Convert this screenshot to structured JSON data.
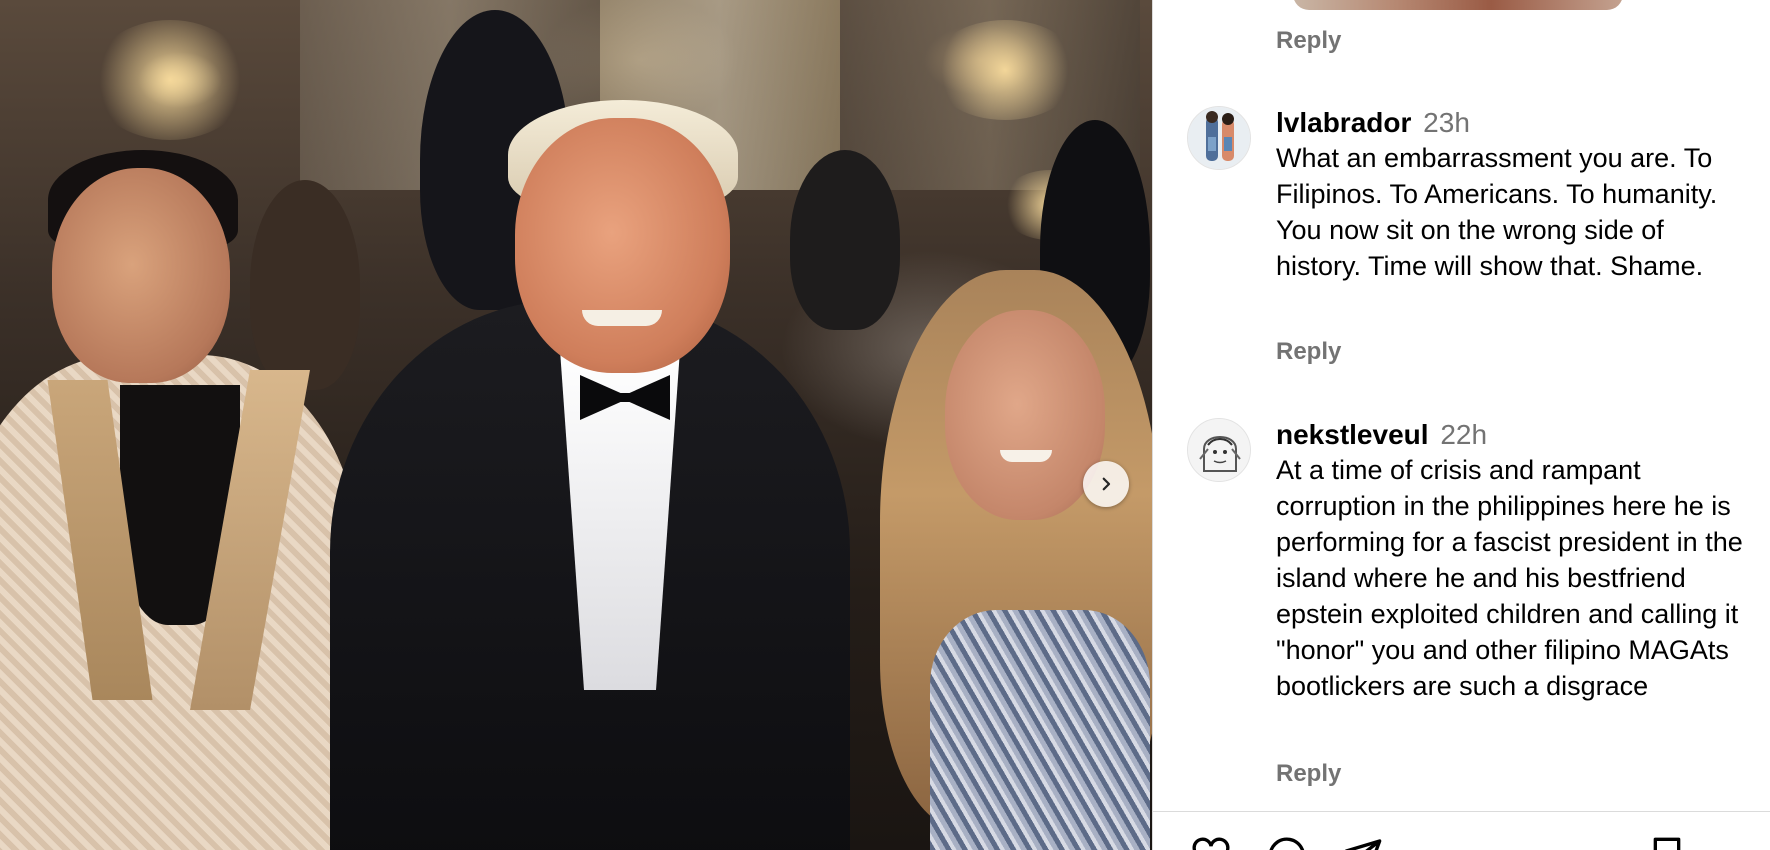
{
  "photo": {
    "next_icon": "chevron-right-icon"
  },
  "comments_panel": {
    "first_reply_label": "Reply",
    "comments": [
      {
        "username": "lvlabrador",
        "time": "23h",
        "text": "What an embarrassment you are. To Filipinos. To Americans. To humanity. You now sit on the wrong side of history. Time will show that. Shame.",
        "reply_label": "Reply",
        "like_icon": "heart-outline-icon"
      },
      {
        "username": "nekstleveul",
        "time": "22h",
        "text": "At a time of crisis and rampant corruption in the philippines here he is performing for a fascist president in the island where he and his bestfriend epstein exploited children and calling it \"honor\" you and other filipino MAGAts bootlickers are such a disgrace",
        "reply_label": "Reply",
        "like_icon": "heart-outline-icon"
      }
    ],
    "action_bar": [
      {
        "name": "like-icon"
      },
      {
        "name": "comment-icon"
      },
      {
        "name": "share-icon"
      },
      {
        "name": "save-icon"
      }
    ],
    "colors": {
      "secondary_text": "#737373",
      "border": "#dbdbdb"
    }
  }
}
